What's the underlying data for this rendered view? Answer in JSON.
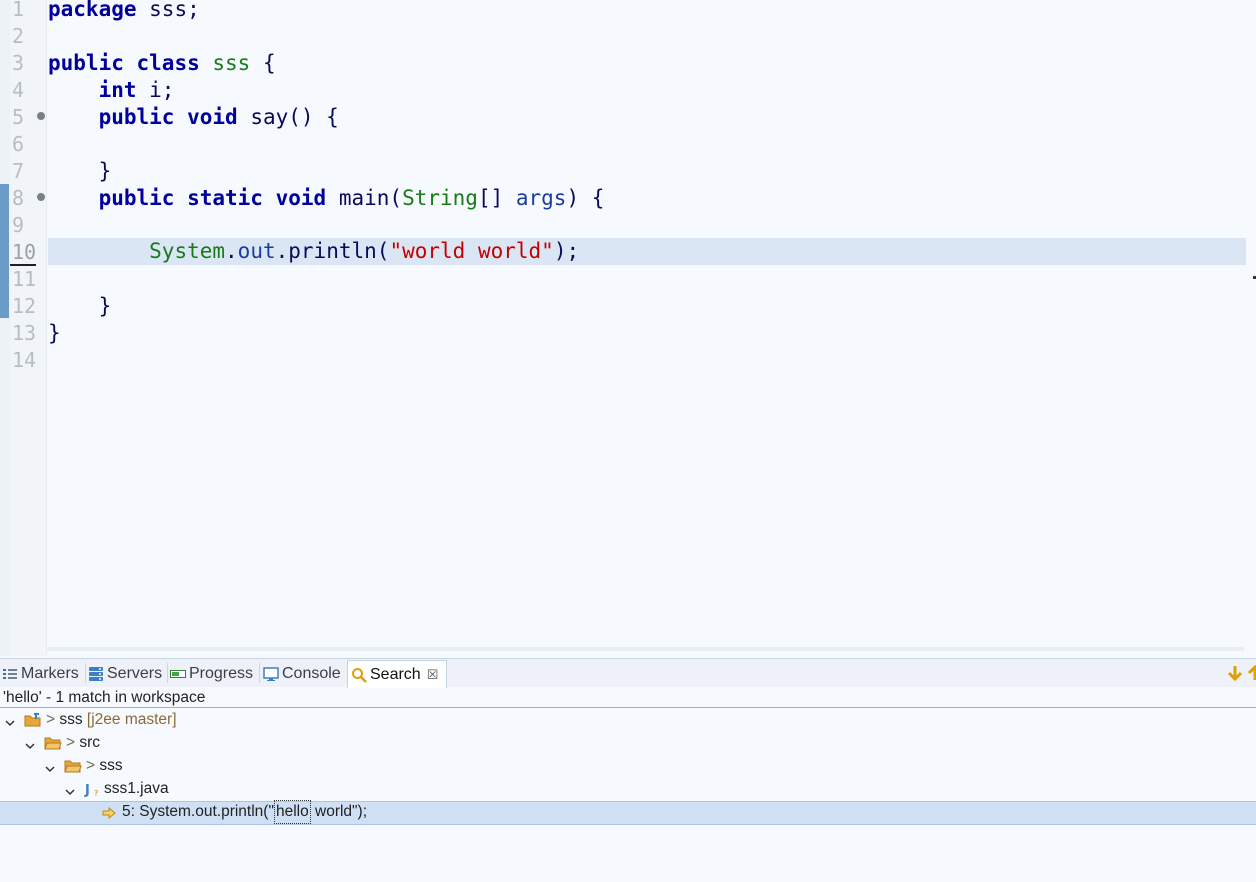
{
  "editor": {
    "line_numbers": [
      "1",
      "2",
      "3",
      "4",
      "5",
      "6",
      "7",
      "8",
      "9",
      "10",
      "11",
      "12",
      "13",
      "14"
    ],
    "current_line": "10",
    "code": {
      "l1": {
        "kw": "package",
        "rest": " sss;"
      },
      "l3": {
        "kw1": "public",
        "kw2": "class",
        "name": "sss",
        "rest": " {"
      },
      "l4": {
        "kw": "int",
        "rest": " i;"
      },
      "l5": {
        "kw1": "public",
        "kw2": "void",
        "rest": " say() {"
      },
      "l7": {
        "rest": "}"
      },
      "l8": {
        "kw1": "public",
        "kw2": "static",
        "kw3": "void",
        "name": "main",
        "paren": "(",
        "type": "String",
        "brackets": "[] ",
        "arg": "args",
        "rest": ") {"
      },
      "l10": {
        "cls": "System",
        "dot1": ".",
        "field": "out",
        "dot2": ".",
        "method": "println",
        "open": "(",
        "str": "\"world world\"",
        "close": ");"
      },
      "l12": {
        "rest": "}"
      },
      "l13": {
        "rest": "}"
      }
    }
  },
  "panel": {
    "tabs": [
      {
        "label": "Markers",
        "icon": "markers-icon"
      },
      {
        "label": "Servers",
        "icon": "servers-icon"
      },
      {
        "label": "Progress",
        "icon": "progress-icon"
      },
      {
        "label": "Console",
        "icon": "console-icon"
      },
      {
        "label": "Search",
        "icon": "search-icon",
        "active": true
      }
    ],
    "summary": "'hello' - 1 match in workspace",
    "tree": {
      "project": {
        "prefix": "> ",
        "label": "sss",
        "git": " [j2ee master]"
      },
      "src": {
        "prefix": "> ",
        "label": "src"
      },
      "package": {
        "prefix": "> ",
        "label": "sss"
      },
      "file": {
        "label": "sss1.java"
      },
      "match": {
        "before": "5: System.out.println(\"",
        "match": "hello",
        "after": " world\");"
      }
    }
  },
  "colors": {
    "keyword": "#00009c",
    "type": "#1a7a1a",
    "string": "#c40000",
    "current_line_highlight": "#dbe6f4",
    "selection": "#cfe0f5"
  }
}
